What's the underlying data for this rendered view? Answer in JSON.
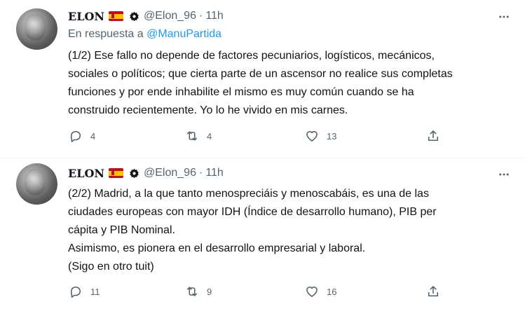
{
  "tweets": [
    {
      "name": "ELON",
      "handle": "@Elon_96",
      "separator": "·",
      "time": "11h",
      "reply_prefix": "En respuesta a",
      "reply_to": "@ManuPartida",
      "text": "(1/2) Ese fallo no depende de factores pecuniarios, logísticos, mecánicos,\nsociales o políticos; que cierta parte de un ascensor no realice sus completas\nfunciones y por ende inhabilite el mismo es muy común cuando se ha\nconstruido recientemente. Yo lo he vivido en mis carnes.",
      "replies": "4",
      "retweets": "4",
      "likes": "13"
    },
    {
      "name": "ELON",
      "handle": "@Elon_96",
      "separator": "·",
      "time": "11h",
      "text": "(2/2) Madrid, a la que tanto menospreciáis y menoscabáis, es una de las\nciudades europeas con mayor IDH (Índice de desarrollo humano), PIB per\ncápita y PIB Nominal.\nAsimismo, es pionera en el desarrollo empresarial y laboral.\n(Sigo en otro tuit)",
      "replies": "11",
      "retweets": "9",
      "likes": "16"
    }
  ],
  "icons": {
    "flag": "spain-flag-icon",
    "badge": "gear-badge-icon",
    "more": "more-icon",
    "reply": "reply-icon",
    "retweet": "retweet-icon",
    "like": "like-icon",
    "share": "share-icon"
  },
  "colors": {
    "link": "#1d9bf0",
    "secondary_text": "#536471",
    "primary_text": "#0f1419",
    "divider": "#eff3f4"
  }
}
